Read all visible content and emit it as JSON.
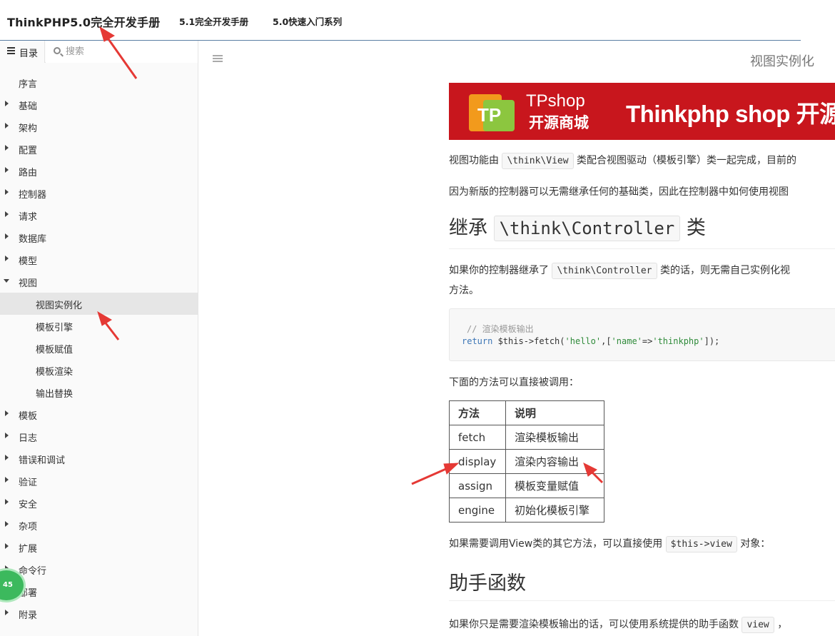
{
  "header": {
    "brand": "ThinkPHP5.0完全开发手册",
    "links": [
      "5.1完全开发手册",
      "5.0快速入门系列"
    ]
  },
  "sidebar": {
    "toc_tab_label": "目录",
    "search_placeholder": "搜索",
    "items": [
      {
        "label": "序言",
        "arrow": "none"
      },
      {
        "label": "基础",
        "arrow": "right"
      },
      {
        "label": "架构",
        "arrow": "right"
      },
      {
        "label": "配置",
        "arrow": "right"
      },
      {
        "label": "路由",
        "arrow": "right"
      },
      {
        "label": "控制器",
        "arrow": "right"
      },
      {
        "label": "请求",
        "arrow": "right"
      },
      {
        "label": "数据库",
        "arrow": "right"
      },
      {
        "label": "模型",
        "arrow": "right"
      },
      {
        "label": "视图",
        "arrow": "down"
      },
      {
        "label": "视图实例化",
        "sub": true,
        "active": true
      },
      {
        "label": "模板引擎",
        "sub": true
      },
      {
        "label": "模板赋值",
        "sub": true
      },
      {
        "label": "模板渲染",
        "sub": true
      },
      {
        "label": "输出替换",
        "sub": true
      },
      {
        "label": "模板",
        "arrow": "right"
      },
      {
        "label": "日志",
        "arrow": "right"
      },
      {
        "label": "错误和调试",
        "arrow": "right"
      },
      {
        "label": "验证",
        "arrow": "right"
      },
      {
        "label": "安全",
        "arrow": "right"
      },
      {
        "label": "杂项",
        "arrow": "right"
      },
      {
        "label": "扩展",
        "arrow": "right"
      },
      {
        "label": "命令行",
        "arrow": "right"
      },
      {
        "label": "部署",
        "arrow": "right"
      },
      {
        "label": "附录",
        "arrow": "right"
      }
    ],
    "badge": "45"
  },
  "main": {
    "page_title": "视图实例化",
    "banner": {
      "logo_letters": "TP",
      "line1": "TPshop",
      "line2": "开源商城",
      "headline": "Thinkphp shop 开源"
    },
    "p1": {
      "before": "视图功能由 ",
      "code": "\\think\\View",
      "after": " 类配合视图驱动（模板引擎）类一起完成，目前的"
    },
    "p2": "因为新版的控制器可以无需继承任何的基础类，因此在控制器中如何使用视图",
    "h2_1": {
      "before": "继承 ",
      "code": "\\think\\Controller",
      "after": " 类"
    },
    "p3": {
      "before": "如果你的控制器继承了 ",
      "code": "\\think\\Controller",
      "after": " 类的话，则无需自己实例化视"
    },
    "p3b": "方法。",
    "code_comment": "// 渲染模板输出",
    "code_line": {
      "kw": "return",
      "var": " $this->fetch(",
      "s1": "'hello'",
      "mid": ",[",
      "s2": "'name'",
      "arrow": "=>",
      "s3": "'thinkphp'",
      "end": "]);"
    },
    "p4": "下面的方法可以直接被调用：",
    "table": {
      "headers": [
        "方法",
        "说明"
      ],
      "rows": [
        [
          "fetch",
          "渲染模板输出"
        ],
        [
          "display",
          "渲染内容输出"
        ],
        [
          "assign",
          "模板变量赋值"
        ],
        [
          "engine",
          "初始化模板引擎"
        ]
      ]
    },
    "p5": {
      "before": "如果需要调用View类的其它方法，可以直接使用 ",
      "code": "$this->view",
      "after": " 对象："
    },
    "h2_2": "助手函数",
    "p6": {
      "before": "如果你只是需要渲染模板输出的话，可以使用系统提供的助手函数 ",
      "code": "view",
      "after": " ，"
    }
  },
  "colors": {
    "banner_red": "#c8161d",
    "annotation_red": "#e53935",
    "header_rule": "#5b7ea3",
    "active_row": "#e6e6e6"
  }
}
